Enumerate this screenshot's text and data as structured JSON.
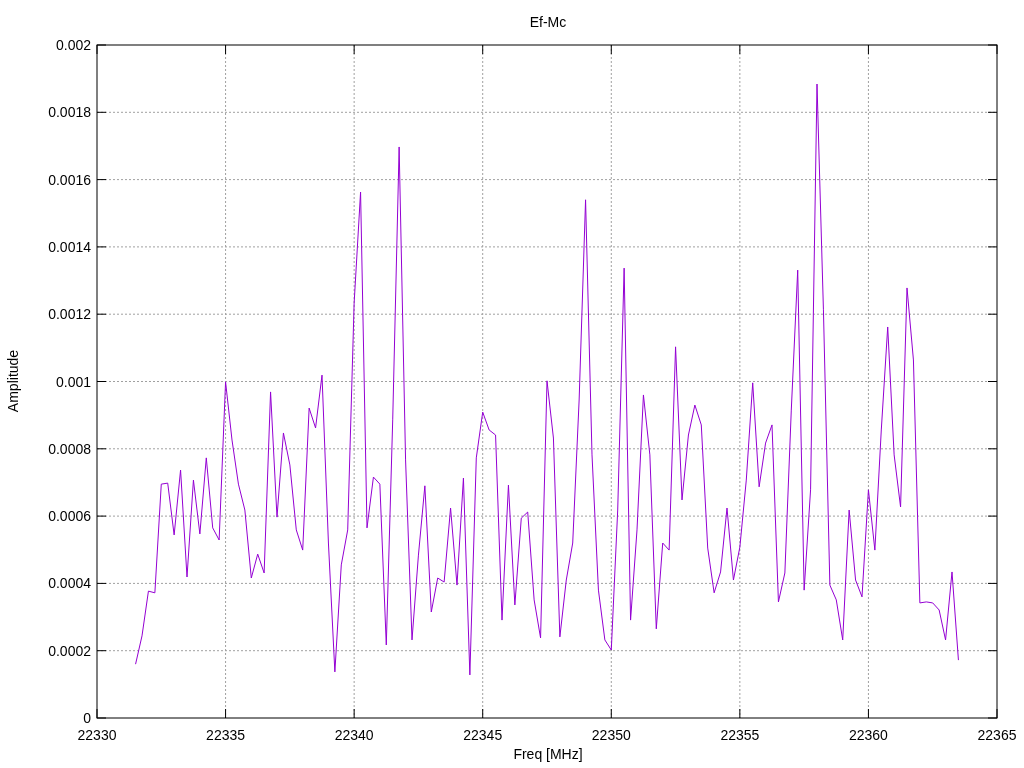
{
  "chart_data": {
    "type": "line",
    "title": "Ef-Mc",
    "xlabel": "Freq [MHz]",
    "ylabel": "Amplitude",
    "x": [
      22331.5,
      22331.75,
      22332,
      22332.25,
      22332.5,
      22332.75,
      22333,
      22333.25,
      22333.5,
      22333.75,
      22334,
      22334.25,
      22334.5,
      22334.75,
      22335,
      22335.25,
      22335.5,
      22335.75,
      22336,
      22336.25,
      22336.5,
      22336.75,
      22337,
      22337.25,
      22337.5,
      22337.75,
      22338,
      22338.25,
      22338.5,
      22338.75,
      22339,
      22339.25,
      22339.5,
      22339.75,
      22340,
      22340.25,
      22340.5,
      22340.75,
      22341,
      22341.25,
      22341.5,
      22341.75,
      22342,
      22342.25,
      22342.5,
      22342.75,
      22343,
      22343.25,
      22343.5,
      22343.75,
      22344,
      22344.25,
      22344.5,
      22344.75,
      22345,
      22345.25,
      22345.5,
      22345.75,
      22346,
      22346.25,
      22346.5,
      22346.75,
      22347,
      22347.25,
      22347.5,
      22347.75,
      22348,
      22348.25,
      22348.5,
      22348.75,
      22349,
      22349.25,
      22349.5,
      22349.75,
      22350,
      22350.25,
      22350.5,
      22350.75,
      22351,
      22351.25,
      22351.5,
      22351.75,
      22352,
      22352.25,
      22352.5,
      22352.75,
      22353,
      22353.25,
      22353.5,
      22353.75,
      22354,
      22354.25,
      22354.5,
      22354.75,
      22355,
      22355.25,
      22355.5,
      22355.75,
      22356,
      22356.25,
      22356.5,
      22356.75,
      22357,
      22357.25,
      22357.5,
      22357.75,
      22358,
      22358.25,
      22358.5,
      22358.75,
      22359,
      22359.25,
      22359.5,
      22359.75,
      22360,
      22360.25,
      22360.5,
      22360.75,
      22361,
      22361.25,
      22361.5,
      22361.75,
      22362,
      22362.25,
      22362.5,
      22362.75,
      22363,
      22363.25,
      22363.5
    ],
    "grid": true,
    "series": [
      {
        "color": "#9400d3",
        "values": [
          0.00016,
          0.000244,
          0.000377,
          0.000372,
          0.000695,
          0.000698,
          0.000544,
          0.000737,
          0.000419,
          0.000707,
          0.000547,
          0.000773,
          0.000565,
          0.000529,
          0.000999,
          0.000826,
          0.000695,
          0.000618,
          0.000416,
          0.000487,
          0.000431,
          0.000969,
          0.000597,
          0.000847,
          0.000752,
          0.000559,
          0.000499,
          0.000921,
          0.000862,
          0.001019,
          0.00052,
          0.000137,
          0.000455,
          0.000559,
          0.001233,
          0.001563,
          0.000565,
          0.000716,
          0.000695,
          0.000217,
          0.000886,
          0.001697,
          0.000767,
          0.000232,
          0.000484,
          0.00069,
          0.000315,
          0.000416,
          0.000404,
          0.000624,
          0.000395,
          0.000713,
          0.000128,
          0.000773,
          0.000909,
          0.000856,
          0.000841,
          0.000291,
          0.000692,
          0.000336,
          0.000594,
          0.000612,
          0.000351,
          0.000238,
          0.001002,
          0.000832,
          0.000241,
          0.00041,
          0.00052,
          0.000945,
          0.00154,
          0.000782,
          0.00038,
          0.000232,
          0.000202,
          0.000618,
          0.001337,
          0.000291,
          0.000559,
          0.00096,
          0.000782,
          0.000265,
          0.00052,
          0.000499,
          0.001103,
          0.000648,
          0.000841,
          0.00093,
          0.000871,
          0.000505,
          0.000372,
          0.000434,
          0.000624,
          0.00041,
          0.000508,
          0.000707,
          0.000996,
          0.000687,
          0.000817,
          0.000871,
          0.000345,
          0.000431,
          0.000915,
          0.001331,
          0.00038,
          0.000678,
          0.001884,
          0.001213,
          0.000395,
          0.000351,
          0.000232,
          0.000618,
          0.00041,
          0.00036,
          0.000678,
          0.000499,
          0.000856,
          0.001162,
          0.000782,
          0.000627,
          0.001278,
          0.001064,
          0.000342,
          0.000345,
          0.000342,
          0.000321,
          0.000232,
          0.000434,
          0.000172
        ]
      }
    ],
    "xlim": [
      22330,
      22365
    ],
    "ylim": [
      0,
      0.002
    ],
    "xticks": [
      22330,
      22335,
      22340,
      22345,
      22350,
      22355,
      22360,
      22365
    ],
    "yticks": [
      0,
      0.0002,
      0.0004,
      0.0006,
      0.0008,
      0.001,
      0.0012,
      0.0014,
      0.0016,
      0.0018,
      0.002
    ]
  }
}
